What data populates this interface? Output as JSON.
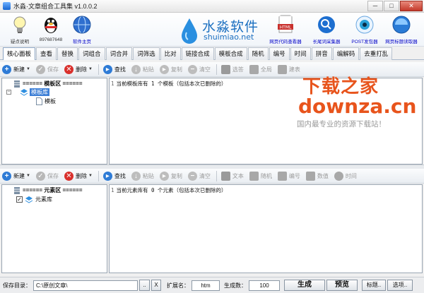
{
  "window": {
    "title": "水淼·文章组合工具集 v1.0.0.2",
    "controls": [
      "─",
      "□",
      "✕"
    ]
  },
  "banner": {
    "help_label": "疑点说明",
    "qq_label": "897687648",
    "homepage_label": "软件主页",
    "brand_cn": "水淼软件",
    "brand_en": "shuimiao.net",
    "tools": [
      {
        "label": "网页代码查看器"
      },
      {
        "label": "长尾词采集器"
      },
      {
        "label": "POST发包器"
      },
      {
        "label": "网页标题读取器"
      }
    ]
  },
  "tabs": [
    "核心面板",
    "查看",
    "替换",
    "词组合",
    "词合并",
    "词筛选",
    "比对",
    "链接合成",
    "模板合成",
    "随机",
    "编号",
    "时间",
    "拼音",
    "编解码",
    "去重打乱"
  ],
  "active_tab": 0,
  "toolbar_top": {
    "new": "新建",
    "save": "保存",
    "delete": "删除",
    "find": "查找",
    "paste": "粘贴",
    "copy": "复制",
    "clear": "清空",
    "extra": [
      "选答",
      "全局",
      "建表"
    ]
  },
  "template_tree": {
    "header": "====== 模板区 ======",
    "library": "模板库",
    "item": "模板"
  },
  "template_editor": {
    "line_no": "1",
    "text": "当前模板库有 1 个模板（包括本次已删除的）"
  },
  "toolbar_bottom": {
    "new": "新建",
    "save": "保存",
    "delete": "删除",
    "find": "查找",
    "paste": "粘贴",
    "copy": "复制",
    "clear": "清空",
    "extra": [
      "文本",
      "随机",
      "编号",
      "数值",
      "时间"
    ]
  },
  "element_tree": {
    "header": "====== 元素区 ======",
    "library": "元素库"
  },
  "element_editor": {
    "line_no": "1",
    "text": "当前元素库有 0 个元素（包括本次已删除的）"
  },
  "watermark": {
    "cn": "下载之家",
    "en": "downza.cn",
    "tag": "国内最专业的资源下载站！"
  },
  "statusbar": {
    "save_dir_label": "保存目录：",
    "save_dir_value": "C:\\原创文章\\",
    "browse": "..",
    "clear": "X",
    "ext_label": "扩展名：",
    "ext_value": "htm",
    "count_label": "生成数：",
    "count_value": "100",
    "generate": "生成",
    "preview": "预览",
    "title_btn": "标题..",
    "options_btn": "选项.."
  },
  "colors": {
    "brand_blue": "#1b6fc0",
    "watermark_orange": "#e8541c",
    "link_blue": "#0000c8"
  }
}
